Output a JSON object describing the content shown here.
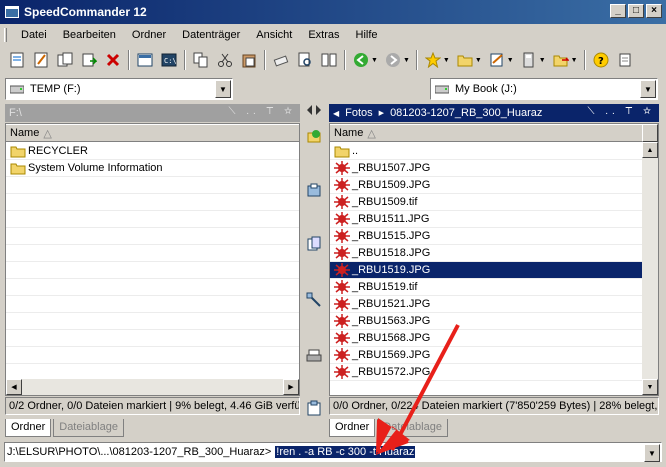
{
  "window": {
    "title": "SpeedCommander 12"
  },
  "menu": [
    "Datei",
    "Bearbeiten",
    "Ordner",
    "Datenträger",
    "Ansicht",
    "Extras",
    "Hilfe"
  ],
  "left": {
    "drive": "TEMP (F:)",
    "path": "F:\\",
    "column": "Name",
    "items": [
      "RECYCLER",
      "System Volume Information"
    ],
    "status": "0/2 Ordner, 0/0 Dateien markiert | 9% belegt, 4.46 GiB verfü",
    "tabs": [
      "Ordner",
      "Dateiablage"
    ]
  },
  "right": {
    "drive": "My Book (J:)",
    "path_parts": [
      "Fotos",
      "081203-1207_RB_300_Huaraz"
    ],
    "column": "Name",
    "items": [
      "..",
      "_RBU1507.JPG",
      "_RBU1509.JPG",
      "_RBU1509.tif",
      "_RBU1511.JPG",
      "_RBU1515.JPG",
      "_RBU1518.JPG",
      "_RBU1519.JPG",
      "_RBU1519.tif",
      "_RBU1521.JPG",
      "_RBU1563.JPG",
      "_RBU1568.JPG",
      "_RBU1569.JPG",
      "_RBU1572.JPG"
    ],
    "selected_index": 7,
    "status": "0/0 Ordner, 0/224 Dateien markiert (7'850'259 Bytes) | 28% belegt, 656",
    "tabs": [
      "Ordner",
      "Dateiablage"
    ]
  },
  "command": {
    "prompt": "J:\\ELSUR\\PHOTO\\...\\081203-1207_RB_300_Huaraz>",
    "value": "!ren . -a RB -c 300 -t Huaraz"
  },
  "colors": {
    "accent": "#0a246a",
    "arrow": "#e8201a",
    "folder": "#f2d46a",
    "file_icon": "#cc2020"
  }
}
